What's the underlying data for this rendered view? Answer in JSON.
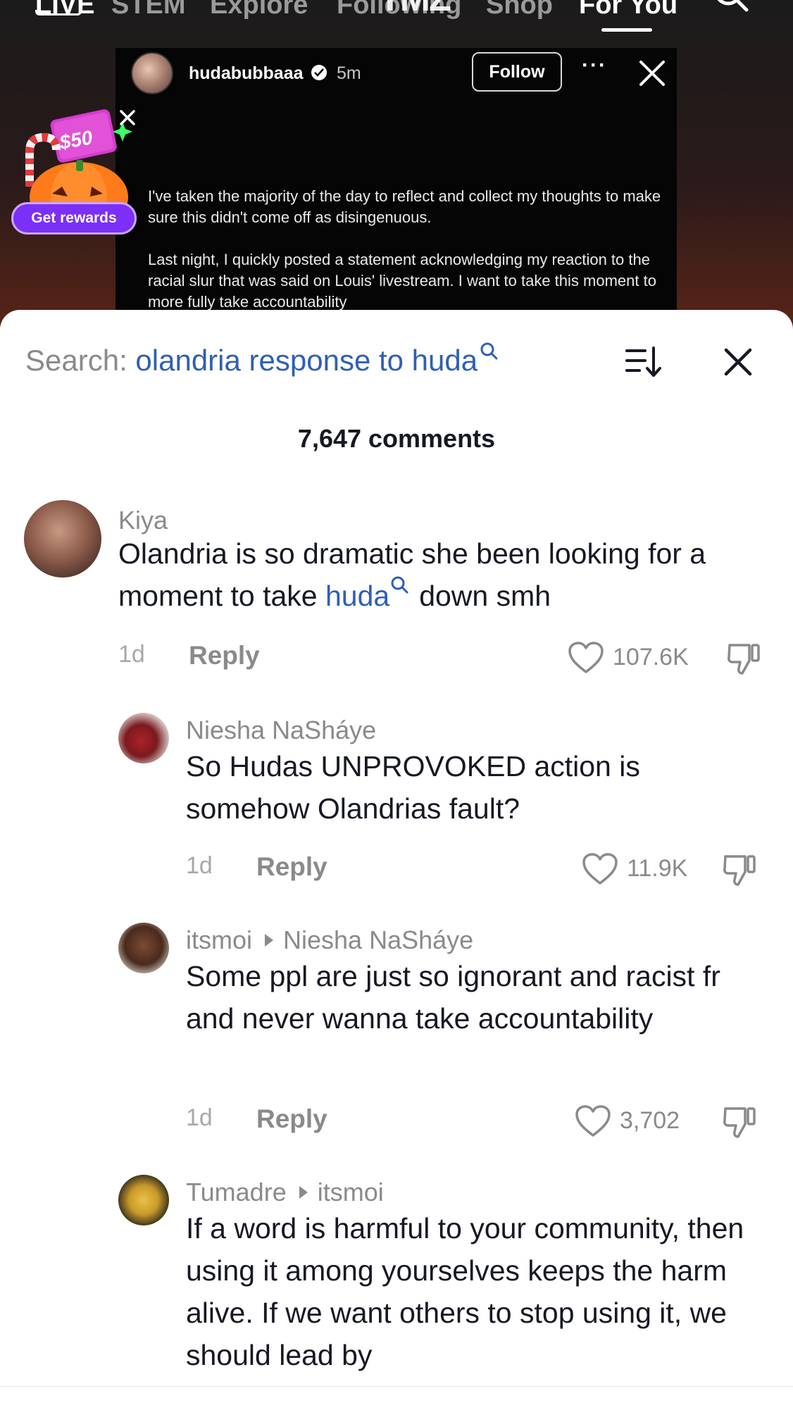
{
  "top_nav": {
    "tabs": [
      {
        "label": "LIVE",
        "active": true
      },
      {
        "label": "STEM",
        "active": false
      },
      {
        "label": "Explore",
        "active": false
      },
      {
        "label": "Following",
        "active": false
      },
      {
        "label": "Shop",
        "active": false
      },
      {
        "label": "For You",
        "active": true
      }
    ],
    "search_icon": "search-icon",
    "overlay_logo": "TMZ"
  },
  "post": {
    "username": "hudabubbaaa",
    "verified": true,
    "time": "5m",
    "follow_label": "Follow",
    "more_label": "···",
    "paragraphs": [
      "I've taken the majority of the day to reflect and collect my thoughts to make sure this didn't come off as disingenuous.",
      "Last night, I quickly posted a statement acknowledging my reaction to the racial slur that was said on Louis' livestream. I want to take this moment to more fully take accountability"
    ]
  },
  "rewards": {
    "amount": "$50",
    "button_label": "Get rewards"
  },
  "comments_panel": {
    "search_prefix": "Search:",
    "search_query": "olandria response to huda",
    "count_label": "7,647 comments",
    "comments": [
      {
        "name": "Kiya",
        "text_before": "Olandria is so dramatic she been looking for a moment to take ",
        "highlight": "huda",
        "text_after": "down smh",
        "time": "1d",
        "reply_label": "Reply",
        "likes": "107.6K"
      },
      {
        "name": "Niesha NaSháye",
        "text": "So Hudas UNPROVOKED action is somehow Olandrias fault?",
        "time": "1d",
        "reply_label": "Reply",
        "likes": "11.9K"
      },
      {
        "name": "itsmoi",
        "reply_to": "Niesha NaSháye",
        "text": "Some ppl are just so ignorant and racist fr and never wanna take accountability",
        "time": "1d",
        "reply_label": "Reply",
        "likes": "3,702"
      },
      {
        "name": "Tumadre",
        "reply_to": "itsmoi",
        "text": "If a word is harmful to your community, then using it among yourselves keeps the harm alive. If we want others to stop using it, we should lead by"
      }
    ]
  },
  "colors": {
    "accent_link": "#2f5fb5",
    "rewards_purple": "#7b2ff7",
    "text_primary": "#161823",
    "text_secondary": "#8a8a8a"
  }
}
